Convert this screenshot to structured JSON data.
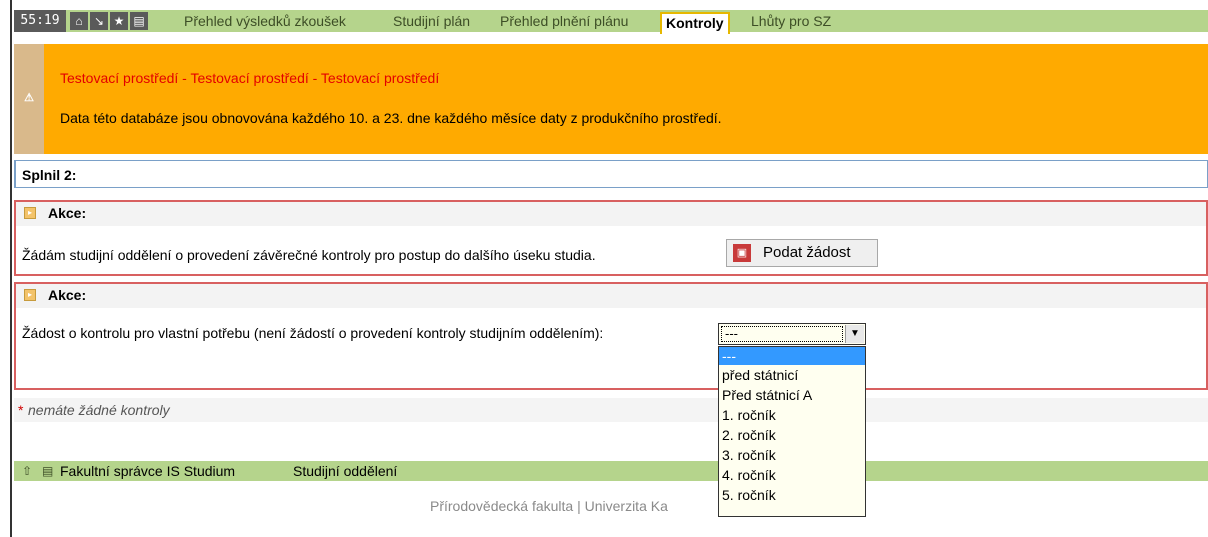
{
  "nav": {
    "timer": "55:19",
    "icons": [
      "home-icon",
      "arrow-icon",
      "star-icon",
      "print-icon"
    ],
    "links": [
      {
        "label": "Přehled výsledků zkoušek",
        "active": false
      },
      {
        "label": "Studijní plán",
        "active": false
      },
      {
        "label": "Přehled plnění plánu",
        "active": false
      },
      {
        "label": "Kontroly",
        "active": true
      },
      {
        "label": "Lhůty pro SZ",
        "active": false
      }
    ]
  },
  "banner": {
    "title": "Testovací prostředí - Testovací prostředí - Testovací prostředí",
    "text": "Data této databáze jsou obnovována každého 10. a 23. dne každého měsíce daty z produkčního prostředí.",
    "bg_color": "#ffaa00",
    "title_color": "#e30000"
  },
  "section": {
    "title": "Splnil 2:"
  },
  "action1": {
    "title": "Akce:",
    "text": "Žádám studijní oddělení o provedení závěrečné kontroly pro postup do dalšího úseku studia.",
    "button_label": "Podat žádost"
  },
  "action2": {
    "title": "Akce:",
    "text": "Žádost o kontrolu pro vlastní potřebu (není žádostí o provedení kontroly studijním oddělením):",
    "select_value": "---",
    "options": [
      "---",
      "před státnicí",
      "Před státnicí A",
      "1. ročník",
      "2. ročník",
      "3. ročník",
      "4. ročník",
      "5. ročník"
    ]
  },
  "note": {
    "star": "*",
    "text": "nemáte žádné kontroly"
  },
  "footer": {
    "links": [
      "Fakultní správce IS Studium",
      "Studijní oddělení"
    ]
  },
  "faculty": "Přírodovědecká fakulta | Univerzita Ka"
}
